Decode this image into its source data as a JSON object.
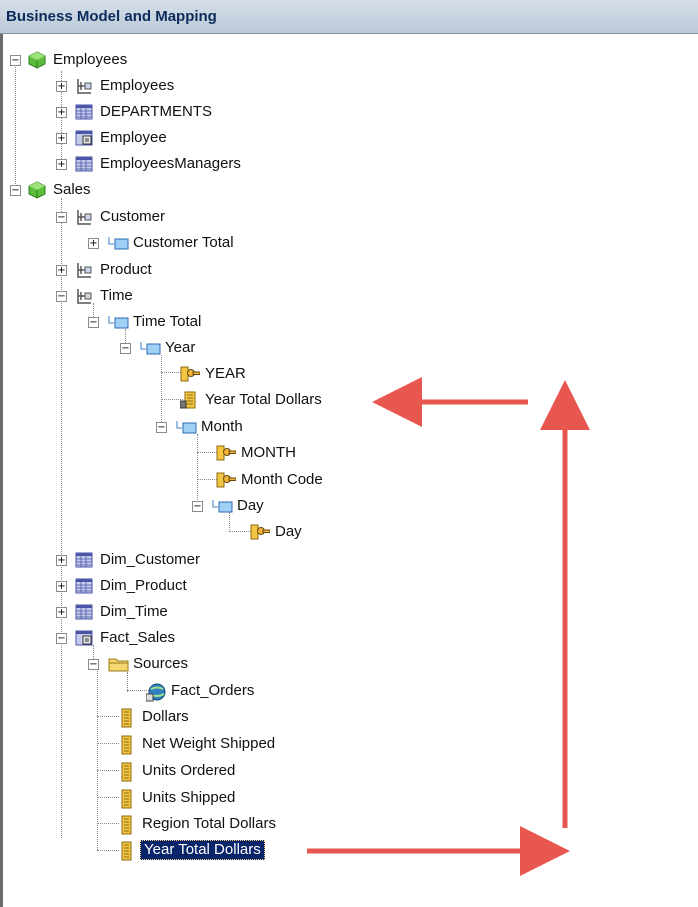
{
  "window": {
    "title": "Business Model and Mapping"
  },
  "tree": {
    "employees": "Employees",
    "employees_hier": "Employees",
    "departments": "DEPARTMENTS",
    "employee": "Employee",
    "employees_managers": "EmployeesManagers",
    "sales": "Sales",
    "customer": "Customer",
    "customer_total": "Customer Total",
    "product": "Product",
    "time": "Time",
    "time_total": "Time Total",
    "year": "Year",
    "year_key": "YEAR",
    "year_total_dollars": "Year Total Dollars",
    "month": "Month",
    "month_key": "MONTH",
    "month_code": "Month Code",
    "day": "Day",
    "day_key": "Day",
    "dim_customer": "Dim_Customer",
    "dim_product": "Dim_Product",
    "dim_time": "Dim_Time",
    "fact_sales": "Fact_Sales",
    "sources": "Sources",
    "fact_orders": "Fact_Orders",
    "dollars": "Dollars",
    "net_weight_shipped": "Net Weight Shipped",
    "units_ordered": "Units Ordered",
    "units_shipped": "Units Shipped",
    "region_total_dollars": "Region Total Dollars",
    "year_total_dollars_measure": "Year Total Dollars"
  },
  "annotation": {
    "arrow_color": "#e8574f"
  }
}
